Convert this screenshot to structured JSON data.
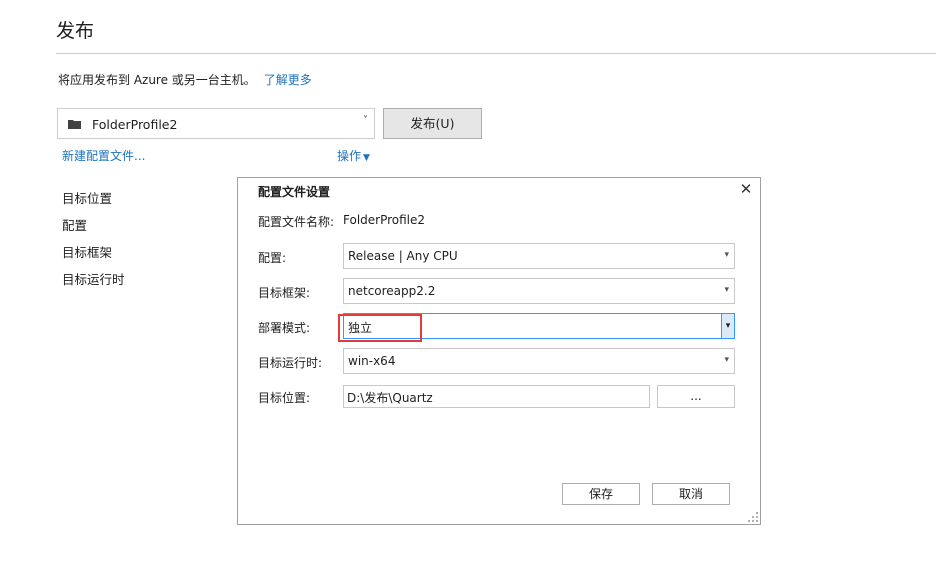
{
  "page": {
    "title": "发布",
    "description": "将应用发布到 Azure 或另一台主机。",
    "learn_more": "了解更多"
  },
  "profile_bar": {
    "selected_profile": "FolderProfile2",
    "publish_button": "发布(U)",
    "new_profile_link": "新建配置文件...",
    "actions_link": "操作"
  },
  "sidebar": {
    "items": [
      {
        "label": "目标位置"
      },
      {
        "label": "配置"
      },
      {
        "label": "目标框架"
      },
      {
        "label": "目标运行时"
      }
    ]
  },
  "dialog": {
    "title": "配置文件设置",
    "profile_name_label": "配置文件名称:",
    "profile_name_value": "FolderProfile2",
    "configuration_label": "配置:",
    "configuration_value": "Release | Any CPU",
    "target_framework_label": "目标框架:",
    "target_framework_value": "netcoreapp2.2",
    "deployment_mode_label": "部署模式:",
    "deployment_mode_value": "独立",
    "target_runtime_label": "目标运行时:",
    "target_runtime_value": "win-x64",
    "target_location_label": "目标位置:",
    "target_location_value": "D:\\发布\\Quartz",
    "browse_button": "...",
    "save_button": "保存",
    "cancel_button": "取消"
  },
  "icons": {
    "folder": "folder-icon",
    "close": "close-icon",
    "dropdown": "chevron-down-icon",
    "resize": "resize-grip-icon"
  },
  "colors": {
    "link": "#1e73be",
    "highlight_border": "#e03c3c",
    "active_border": "#3399ff"
  }
}
